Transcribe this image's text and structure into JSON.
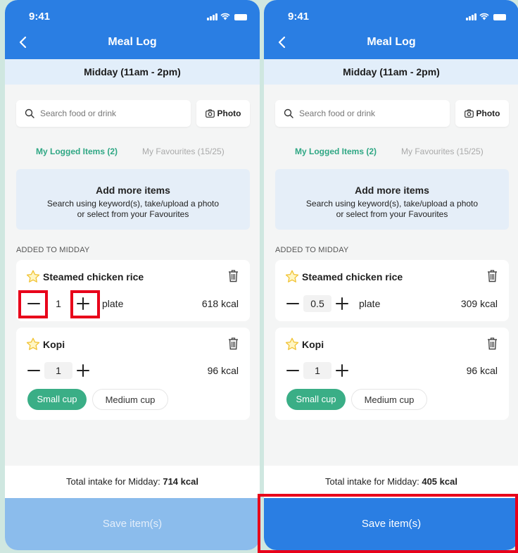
{
  "screens": [
    {
      "status_time": "9:41",
      "header_title": "Meal Log",
      "period": "Midday (11am - 2pm)",
      "search_placeholder": "Search food or drink",
      "photo_label": "Photo",
      "tab_logged": "My Logged Items (2)",
      "tab_favourites": "My Favourites (15/25)",
      "add_title": "Add more items",
      "add_line1": "Search using keyword(s), take/upload a photo",
      "add_line2": "or select from your Favourites",
      "section_label": "ADDED TO MIDDAY",
      "items": [
        {
          "name": "Steamed chicken rice",
          "qty": "1",
          "unit": "plate",
          "kcal": "618 kcal"
        },
        {
          "name": "Kopi",
          "qty": "1",
          "kcal": "96 kcal",
          "option_selected": "Small cup",
          "option_other": "Medium cup"
        }
      ],
      "total_label": "Total intake for Midday:",
      "total_value": "714 kcal",
      "save_label": "Save item(s)",
      "save_enabled": false
    },
    {
      "status_time": "9:41",
      "header_title": "Meal Log",
      "period": "Midday (11am - 2pm)",
      "search_placeholder": "Search food or drink",
      "photo_label": "Photo",
      "tab_logged": "My Logged Items (2)",
      "tab_favourites": "My Favourites (15/25)",
      "add_title": "Add more items",
      "add_line1": "Search using keyword(s), take/upload a photo",
      "add_line2": "or select from your Favourites",
      "section_label": "ADDED TO MIDDAY",
      "items": [
        {
          "name": "Steamed chicken rice",
          "qty": "0.5",
          "unit": "plate",
          "kcal": "309 kcal"
        },
        {
          "name": "Kopi",
          "qty": "1",
          "kcal": "96 kcal",
          "option_selected": "Small cup",
          "option_other": "Medium cup"
        }
      ],
      "total_label": "Total intake for Midday:",
      "total_value": "405 kcal",
      "save_label": "Save item(s)",
      "save_enabled": true
    }
  ],
  "colors": {
    "header_blue": "#2a7ee3",
    "accent_green": "#3aae86",
    "highlight_red": "#e8001a",
    "background": "#cfe7e0"
  }
}
